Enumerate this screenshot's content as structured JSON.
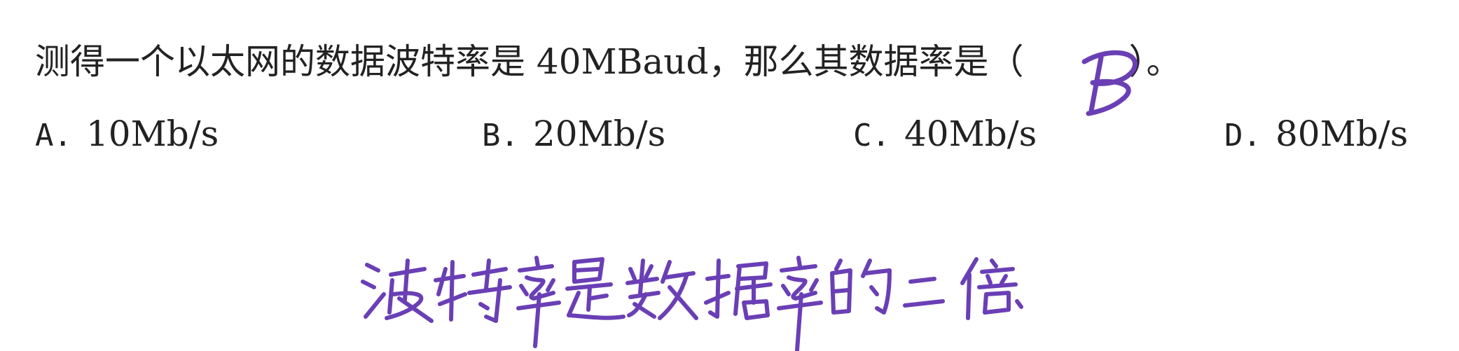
{
  "question": {
    "text": "测得一个以太网的数据波特率是 40MBaud，那么其数据率是（　　　）。"
  },
  "options": [
    {
      "letter": "A.",
      "value": "10Mb/s"
    },
    {
      "letter": "B.",
      "value": "20Mb/s"
    },
    {
      "letter": "C.",
      "value": "40Mb/s"
    },
    {
      "letter": "D.",
      "value": "80Mb/s"
    }
  ],
  "handwriting": {
    "answer": "B",
    "note": "波特率是数据率的二倍",
    "ink_color": "#6a3fb5"
  }
}
